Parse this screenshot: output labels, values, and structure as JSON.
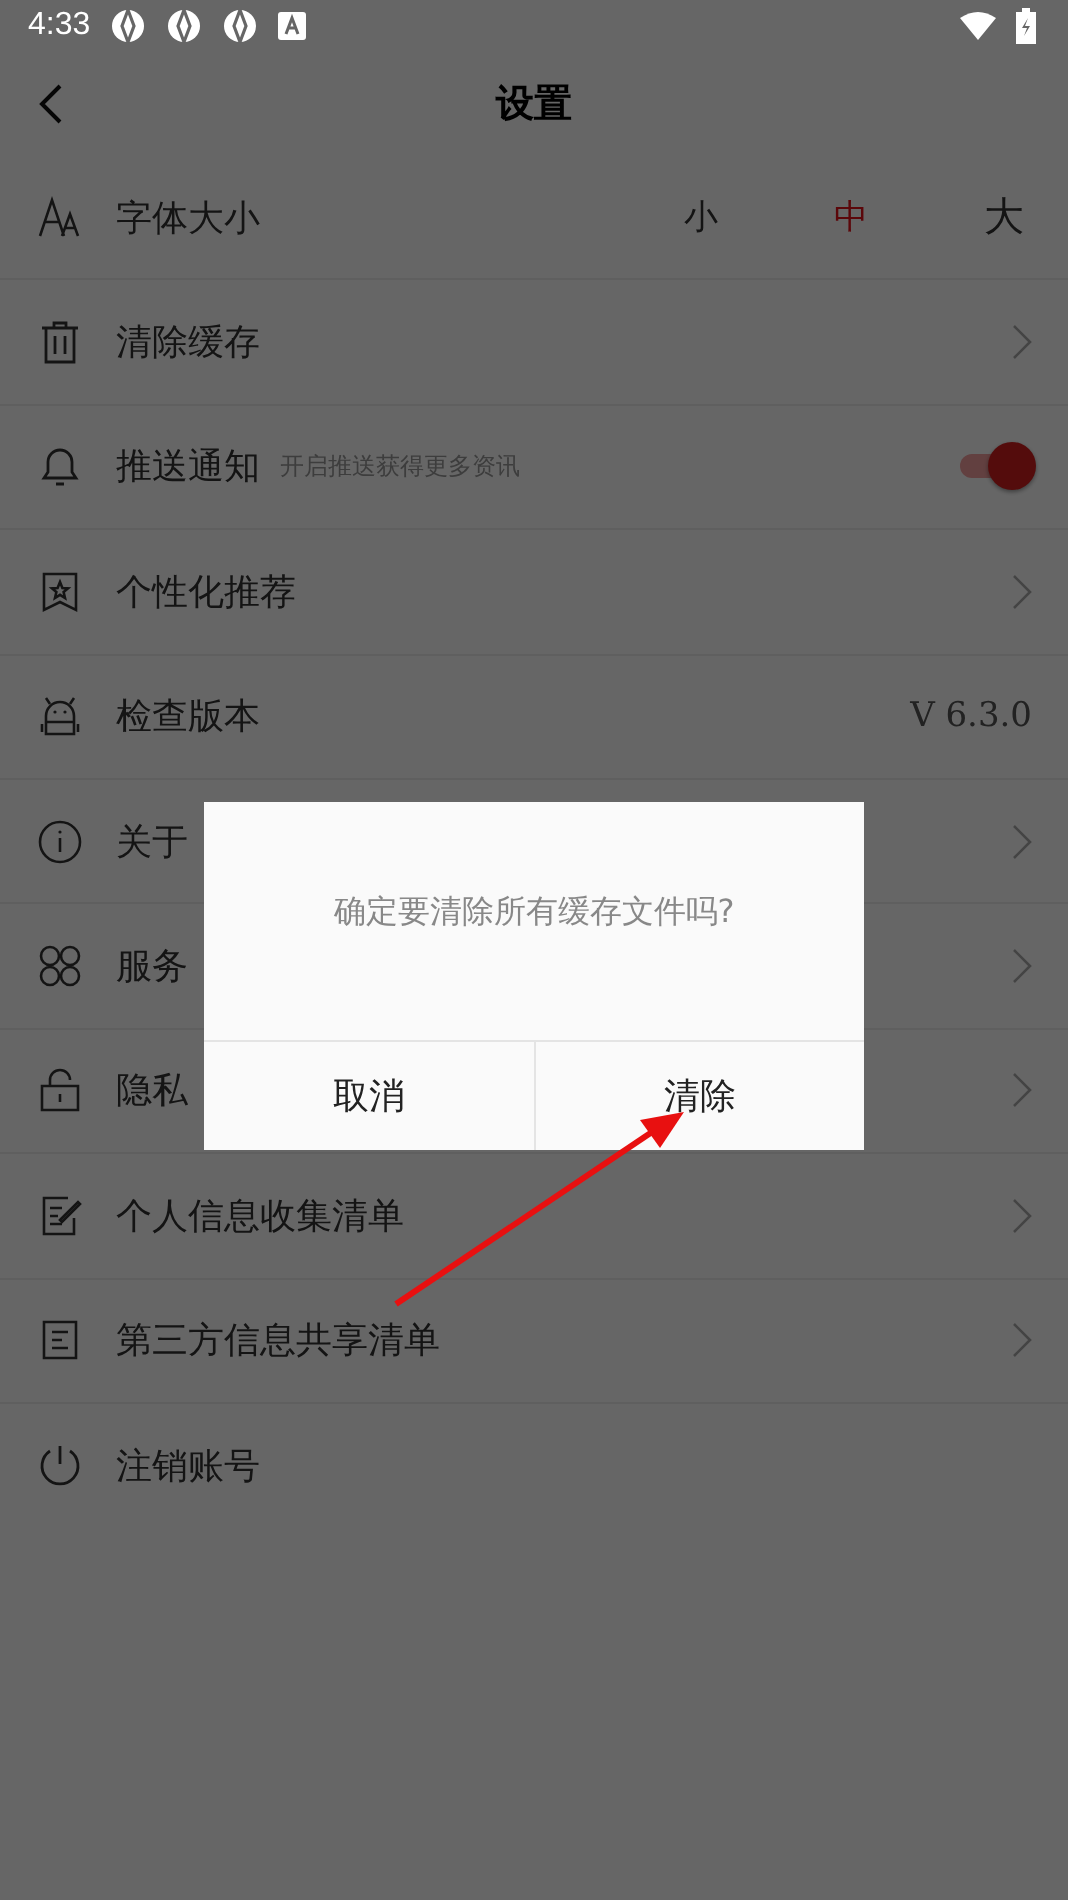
{
  "status_bar": {
    "time": "4:33"
  },
  "header": {
    "title": "设置"
  },
  "settings": [
    {
      "kind": "font_size",
      "label": "字体大小",
      "options": [
        {
          "label": "小",
          "selected": false
        },
        {
          "label": "中",
          "selected": true
        },
        {
          "label": "大",
          "selected": false
        }
      ]
    },
    {
      "kind": "link",
      "label": "清除缓存"
    },
    {
      "kind": "toggle",
      "label": "推送通知",
      "hint": "开启推送获得更多资讯",
      "on": true
    },
    {
      "kind": "link",
      "label": "个性化推荐"
    },
    {
      "kind": "value",
      "label": "检查版本",
      "value": "V 6.3.0"
    },
    {
      "kind": "link",
      "label": "关于"
    },
    {
      "kind": "link",
      "label": "服务"
    },
    {
      "kind": "link",
      "label": "隐私"
    },
    {
      "kind": "link",
      "label": "个人信息收集清单"
    },
    {
      "kind": "link",
      "label": "第三方信息共享清单"
    },
    {
      "kind": "plain",
      "label": "注销账号"
    }
  ],
  "dialog": {
    "message": "确定要清除所有缓存文件吗?",
    "buttons": [
      "取消",
      "清除"
    ]
  }
}
